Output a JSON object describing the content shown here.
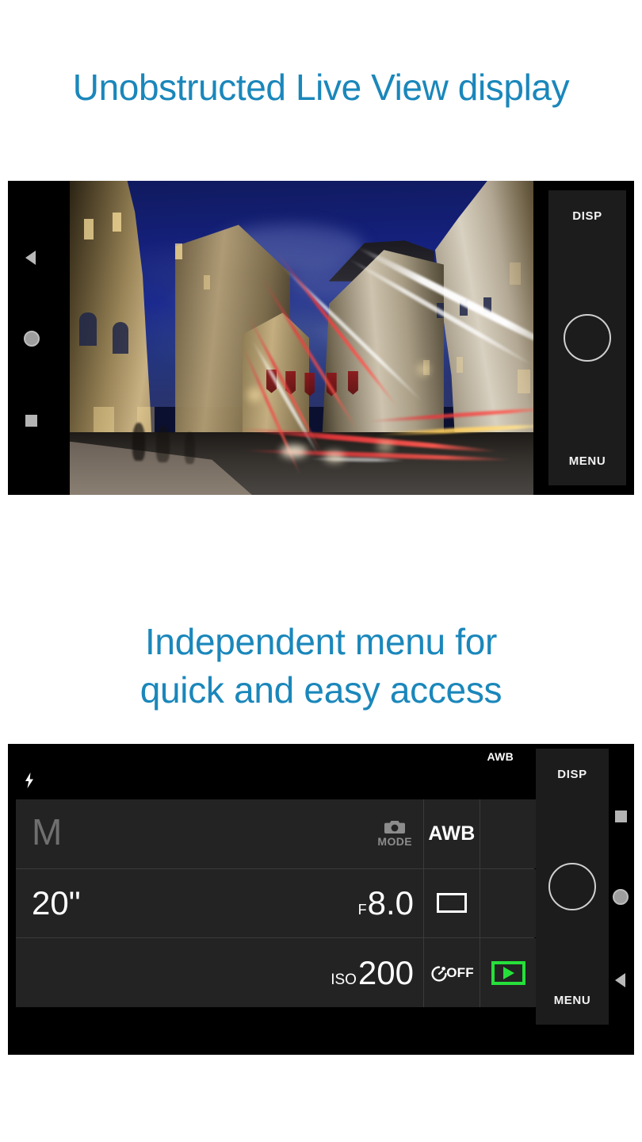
{
  "headings": {
    "section1": "Unobstructed Live View display",
    "section2_line1": "Independent menu for",
    "section2_line2": "quick and easy access"
  },
  "colors": {
    "heading_blue": "#1a87bb",
    "playback_green": "#26e03a",
    "panel_bg": "#1c1c1c",
    "cell_bg": "#232323",
    "screen_black": "#000000"
  },
  "live_view": {
    "rotate_icon": "screen-rotate-icon",
    "control_panel": {
      "disp_label": "DISP",
      "menu_label": "MENU",
      "shutter_label": "shutter-button"
    },
    "nav_bar": {
      "back": "back-triangle-icon",
      "home": "home-circle-icon",
      "recents": "recents-square-icon"
    },
    "photo": {
      "description": "Long exposure night cityscape with vehicle light trails"
    }
  },
  "menu_screen": {
    "status_bar": {
      "flash_icon": "flash-bolt-icon",
      "awb_label": "AWB"
    },
    "grid": {
      "row1": {
        "mode_letter": "M",
        "mode_icon": "camera-icon",
        "mode_label": "MODE",
        "white_balance": "AWB",
        "extra": ""
      },
      "row2": {
        "shutter_speed": "20\"",
        "aperture_prefix": "F",
        "aperture_value": "8.0",
        "drive_mode_icon": "single-shot-rect-icon",
        "extra": ""
      },
      "row3": {
        "iso_prefix": "ISO",
        "iso_value": "200",
        "self_timer_icon": "self-timer-icon",
        "self_timer_value": "OFF",
        "playback_icon": "playback-play-icon"
      }
    },
    "control_panel": {
      "disp_label": "DISP",
      "menu_label": "MENU",
      "shutter_label": "shutter-button"
    },
    "nav_bar": {
      "recents": "recents-square-icon",
      "home": "home-circle-icon",
      "back": "back-triangle-icon"
    }
  }
}
